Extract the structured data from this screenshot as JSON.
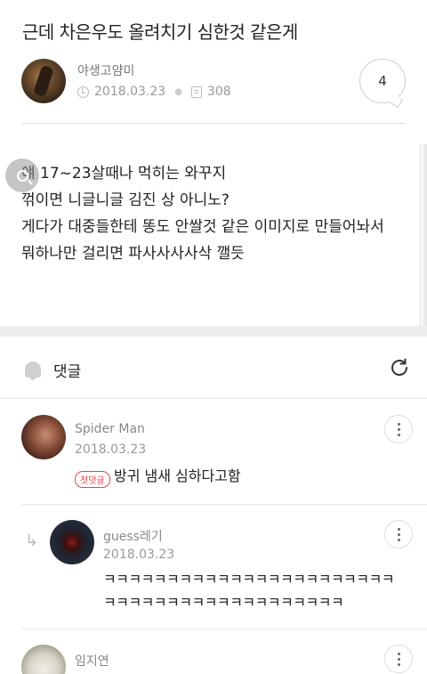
{
  "post": {
    "title": "근데 차은우도 올려치기 심한것 같은게",
    "author": "야생고얌미",
    "date": "2018.03.23",
    "views": "308",
    "comment_count": "4",
    "body": "얘 17~23살때나 먹히는 와꾸지\n꺾이면 니글니글 김진 상 아니노?\n게다가 대중들한테 똥도 안쌀것 같은 이미지로 만들어놔서\n뭐하나만 걸리면 파사사사사삭 깰듯"
  },
  "comments_section": {
    "label": "댓글"
  },
  "comments": [
    {
      "author": "Spider Man",
      "date": "2018.03.23",
      "badge": "첫댓글",
      "text": "방귀 냄새 심하다고함"
    },
    {
      "author": "guess레기",
      "date": "2018.03.23",
      "text": "ㅋㅋㅋㅋㅋㅋㅋㅋㅋㅋㅋㅋㅋㅋㅋㅋㅋㅋㅋㅋㅋㅋㅋㅋㅋㅋㅋㅋㅋㅋㅋㅋㅋㅋㅋㅋㅋㅋㅋㅋㅋㅋ"
    },
    {
      "author": "임지연"
    }
  ],
  "icons": {
    "clock": "clock-icon",
    "views": "views-icon",
    "bell": "bell-icon",
    "refresh": "refresh-icon",
    "more": "more-vertical-icon",
    "reply": "reply-arrow-icon",
    "search": "search-icon"
  },
  "colors": {
    "badge": "#e04646",
    "band": "#eeeeee",
    "divider": "#e4e4e4"
  }
}
